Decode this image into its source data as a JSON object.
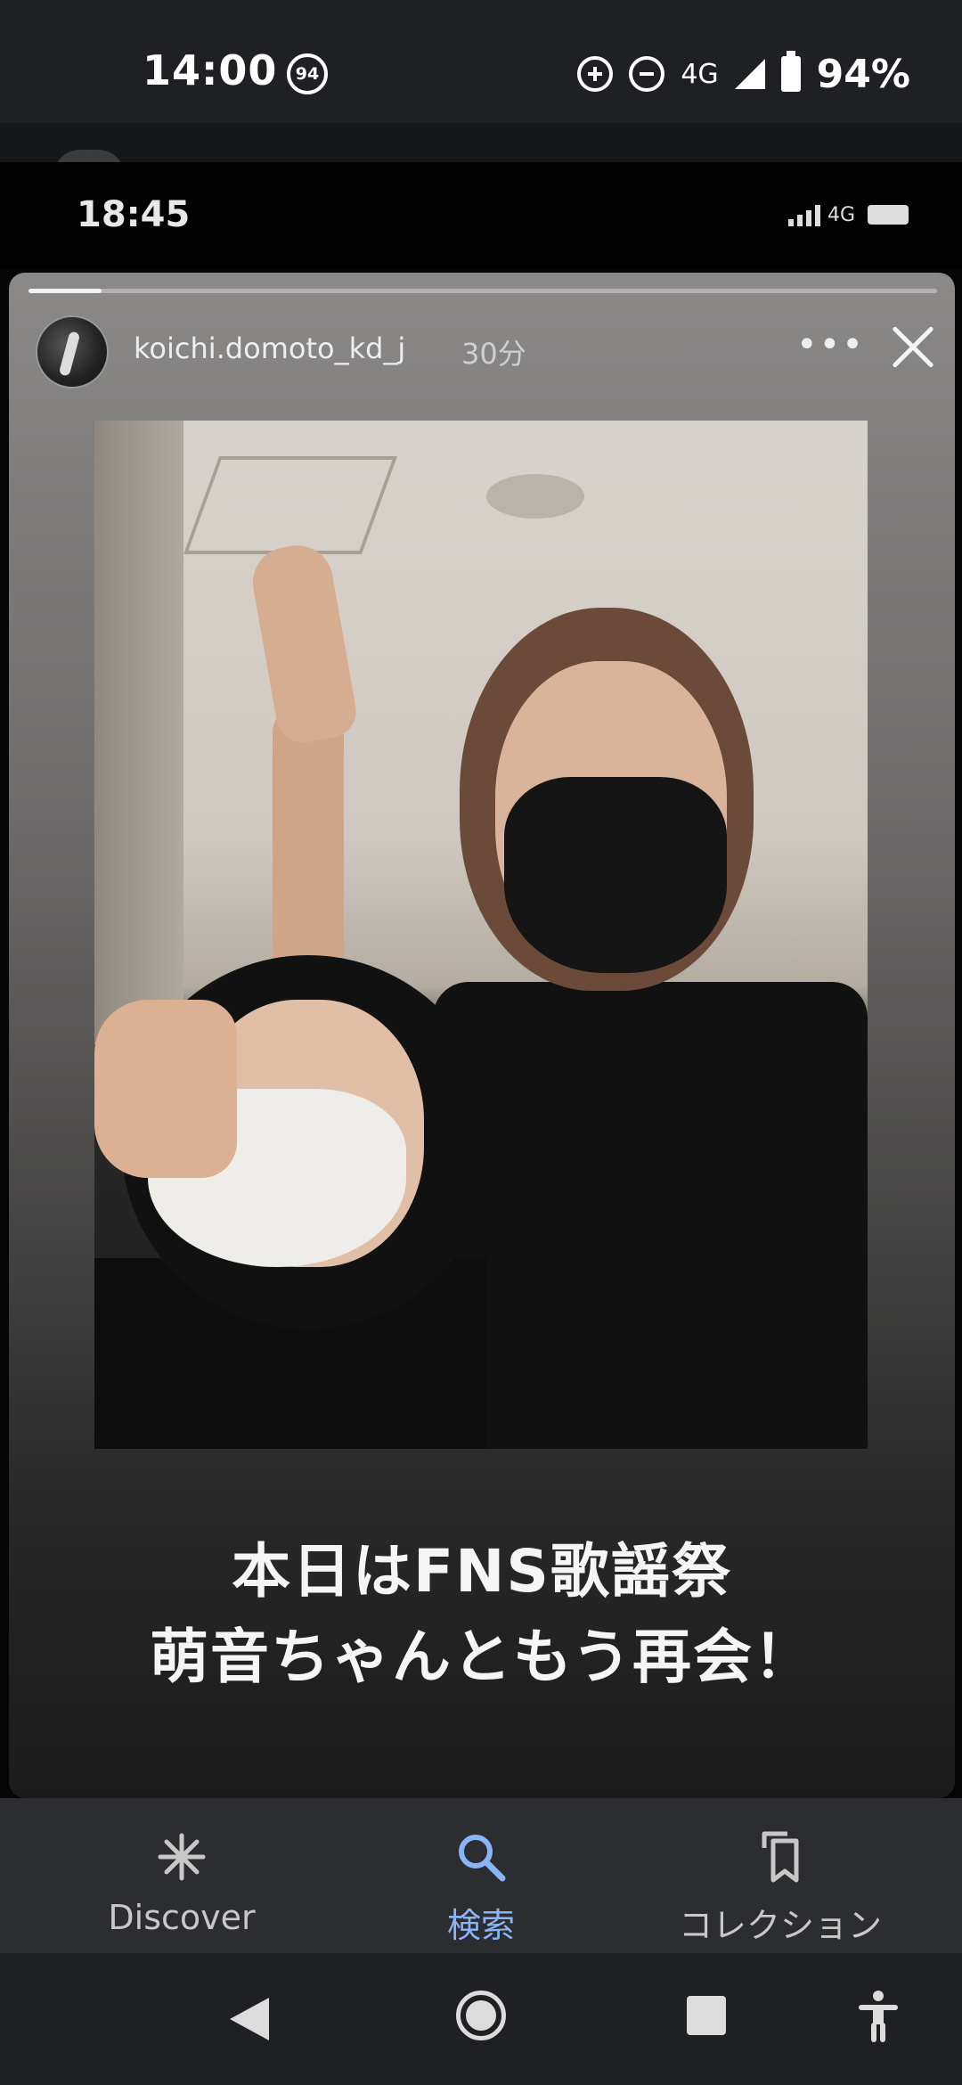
{
  "status_bar": {
    "time": "14:00",
    "notification_badge": "94",
    "network": "4G",
    "battery_percent": "94%"
  },
  "screenshot": {
    "inner_status_bar": {
      "time": "18:45",
      "network": "4G"
    },
    "story": {
      "username": "koichi.domoto_kd_j",
      "posted_ago": "30分",
      "more_label": "•••",
      "progress": 0.08,
      "caption_line1": "本日はFNS歌謡祭",
      "caption_line2": "萌音ちゃんともう再会！"
    }
  },
  "bottom_nav": {
    "items": [
      {
        "label": "Discover",
        "icon": "asterisk-icon",
        "active": false
      },
      {
        "label": "検索",
        "icon": "search-icon",
        "active": true
      },
      {
        "label": "コレクション",
        "icon": "bookmarks-icon",
        "active": false
      }
    ],
    "active_color": "#8ab4f8"
  }
}
